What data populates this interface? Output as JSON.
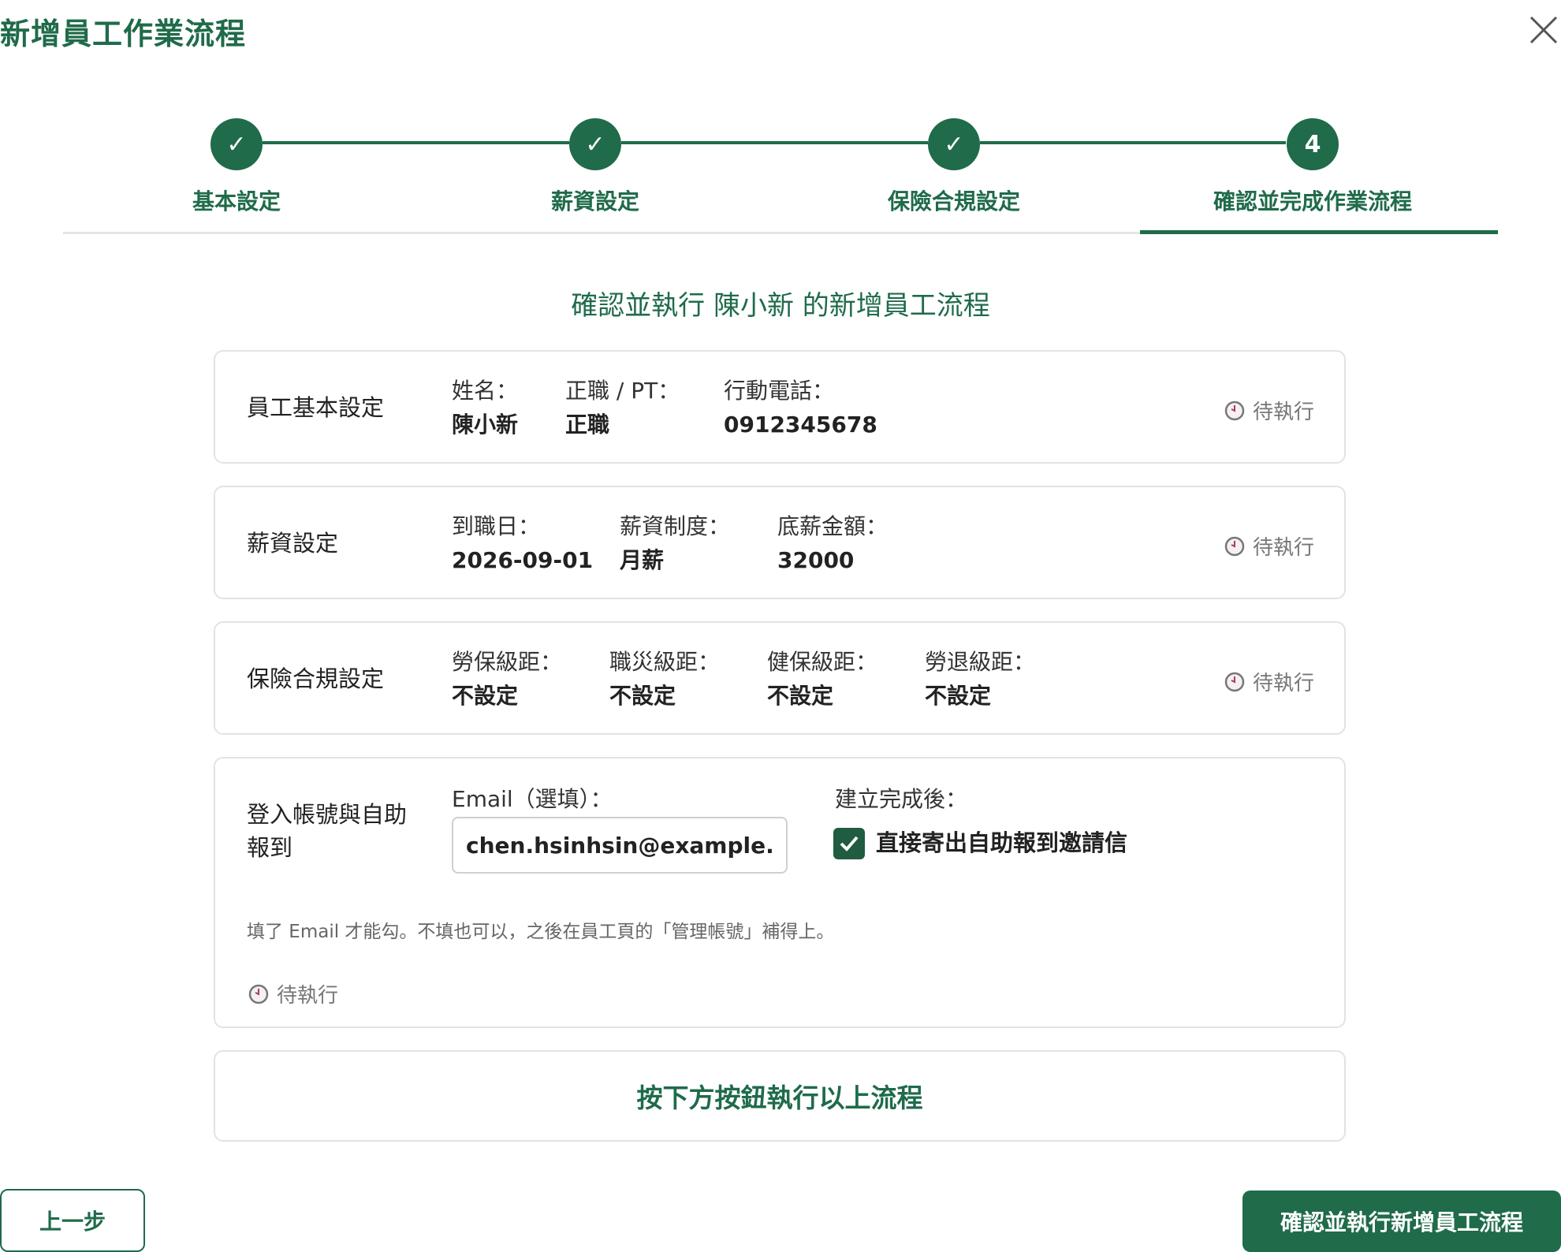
{
  "dialog": {
    "title": "新增員工作業流程"
  },
  "colors": {
    "accent": "#1f6b4a",
    "border": "#e3e3e3",
    "muted": "#777777"
  },
  "steps": [
    {
      "label": "基本設定",
      "marker": "✓",
      "state": "done"
    },
    {
      "label": "薪資設定",
      "marker": "✓",
      "state": "done"
    },
    {
      "label": "保險合規設定",
      "marker": "✓",
      "state": "done"
    },
    {
      "label": "確認並完成作業流程",
      "marker": "4",
      "state": "active"
    }
  ],
  "subtitle": "確認並執行 陳小新 的新增員工流程",
  "pending_text": "待執行",
  "cards": {
    "basic": {
      "title": "員工基本設定",
      "fields": [
        {
          "label": "姓名：",
          "value": "陳小新"
        },
        {
          "label": "正職 / PT：",
          "value": "正職"
        },
        {
          "label": "行動電話：",
          "value": "0912345678"
        }
      ]
    },
    "salary": {
      "title": "薪資設定",
      "fields": [
        {
          "label": "到職日：",
          "value": "2026-09-01"
        },
        {
          "label": "薪資制度：",
          "value": "月薪"
        },
        {
          "label": "底薪金額：",
          "value": "32000"
        }
      ]
    },
    "insurance": {
      "title": "保險合規設定",
      "fields": [
        {
          "label": "勞保級距：",
          "value": "不設定"
        },
        {
          "label": "職災級距：",
          "value": "不設定"
        },
        {
          "label": "健保級距：",
          "value": "不設定"
        },
        {
          "label": "勞退級距：",
          "value": "不設定"
        }
      ]
    },
    "account": {
      "title_line1": "登入帳號與自助",
      "title_line2": "報到",
      "email_label": "Email（選填）：",
      "email_value": "chen.hsinhsin@example.com",
      "after_label": "建立完成後：",
      "checkbox_label": "直接寄出自助報到邀請信",
      "checkbox_checked": true,
      "hint": "填了 Email 才能勾。不填也可以，之後在員工頁的「管理帳號」補得上。"
    },
    "execute": {
      "text": "按下方按鈕執行以上流程"
    }
  },
  "footer": {
    "prev_label": "上一步",
    "confirm_label": "確認並執行新增員工流程"
  }
}
